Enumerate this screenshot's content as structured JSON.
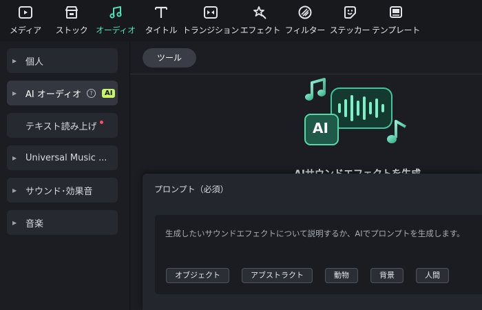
{
  "toolbar": {
    "items": [
      {
        "label": "メディア",
        "icon": "media-icon"
      },
      {
        "label": "ストック",
        "icon": "stock-icon"
      },
      {
        "label": "オーディオ",
        "icon": "audio-icon",
        "active": true
      },
      {
        "label": "タイトル",
        "icon": "title-icon"
      },
      {
        "label": "トランジション",
        "icon": "transition-icon"
      },
      {
        "label": "エフェクト",
        "icon": "effect-icon"
      },
      {
        "label": "フィルター",
        "icon": "filter-icon"
      },
      {
        "label": "ステッカー",
        "icon": "sticker-icon"
      },
      {
        "label": "テンプレート",
        "icon": "template-icon"
      }
    ],
    "active_color": "#4fe0b5"
  },
  "sidebar": {
    "items": [
      {
        "label": "個人"
      },
      {
        "label": "AI オーディオ",
        "help": "?",
        "badge": "AI"
      },
      {
        "label": "テキスト読み上げ"
      },
      {
        "label": "Universal Music ..."
      },
      {
        "label": "サウンド･効果音"
      },
      {
        "label": "音楽"
      }
    ]
  },
  "main": {
    "tab_label": "ツール",
    "hero_title": "AIサウンドエフェクトを生成",
    "hero_badge": "AI",
    "prompt": {
      "label": "プロンプト（必須）",
      "placeholder": "生成したいサウンドエフェクトについて説明するか、AIでプロンプトを生成します。",
      "chips": [
        "オブジェクト",
        "アブストラクト",
        "動物",
        "背景",
        "人間"
      ]
    }
  }
}
